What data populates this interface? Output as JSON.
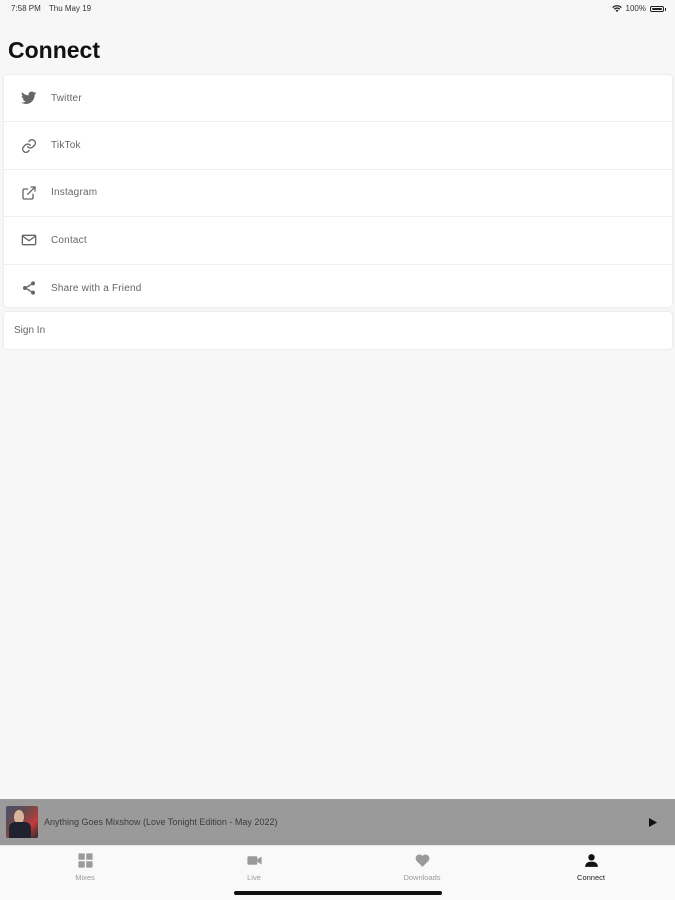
{
  "status_bar": {
    "time": "7:58 PM",
    "date": "Thu May 19",
    "battery": "100%"
  },
  "page": {
    "title": "Connect"
  },
  "menu": {
    "items": [
      {
        "label": "Twitter",
        "icon": "twitter-icon"
      },
      {
        "label": "TikTok",
        "icon": "link-icon"
      },
      {
        "label": "Instagram",
        "icon": "external-link-icon"
      },
      {
        "label": "Contact",
        "icon": "mail-icon"
      },
      {
        "label": "Share with a Friend",
        "icon": "share-icon"
      }
    ]
  },
  "signin": {
    "label": "Sign In"
  },
  "now_playing": {
    "title": "Anything Goes Mixshow (Love Tonight Edition - May 2022)",
    "icon": "play-icon"
  },
  "tabs": [
    {
      "label": "Mixes",
      "icon": "grid-icon",
      "active": false
    },
    {
      "label": "Live",
      "icon": "video-icon",
      "active": false
    },
    {
      "label": "Downloads",
      "icon": "heart-icon",
      "active": false
    },
    {
      "label": "Connect",
      "icon": "person-icon",
      "active": true
    }
  ],
  "colors": {
    "background": "#f7f7f7",
    "card": "#ffffff",
    "player_bar": "#9a9a9a",
    "icon_gray": "#666666",
    "tab_inactive": "#9a9a9a",
    "tab_active": "#222222"
  }
}
